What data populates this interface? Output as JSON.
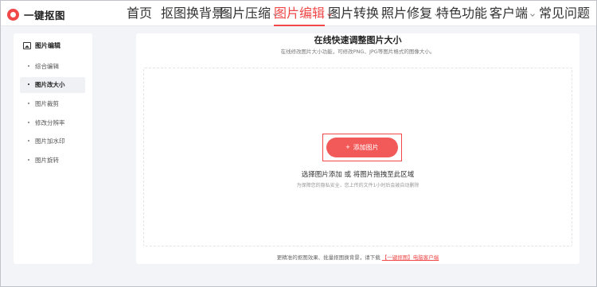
{
  "header": {
    "logo_text": "一键抠图",
    "nav": [
      {
        "label": "首页",
        "has_dropdown": false,
        "active": false
      },
      {
        "label": "抠图换背景",
        "has_dropdown": true,
        "active": false
      },
      {
        "label": "图片压缩",
        "has_dropdown": true,
        "active": false
      },
      {
        "label": "图片编辑",
        "has_dropdown": true,
        "active": true
      },
      {
        "label": "图片转换",
        "has_dropdown": true,
        "active": false
      },
      {
        "label": "照片修复",
        "has_dropdown": true,
        "active": false
      },
      {
        "label": "特色功能",
        "has_dropdown": true,
        "active": false
      },
      {
        "label": "客户端",
        "has_dropdown": true,
        "active": false
      },
      {
        "label": "常见问题",
        "has_dropdown": false,
        "active": false
      }
    ]
  },
  "sidebar": {
    "title": "图片编辑",
    "items": [
      {
        "label": "综合编辑",
        "active": false
      },
      {
        "label": "图片改大小",
        "active": true
      },
      {
        "label": "图片裁剪",
        "active": false
      },
      {
        "label": "修改分辨率",
        "active": false
      },
      {
        "label": "图片加水印",
        "active": false
      },
      {
        "label": "图片旋转",
        "active": false
      }
    ]
  },
  "main": {
    "title": "在线快速调整图片大小",
    "subtitle": "在线修改图片大小功能，可修改PNG、JPG等图片格式的图像大小。",
    "add_button": "添加图片",
    "drop_text": "选择图片添加 或 将图片拖拽至此区域",
    "drop_note": "为保障您的隐私安全，您上传的文件1小时后会被自动删除",
    "footer_text": "更精准的抠图效果、批量抠图换背景，请下载",
    "footer_link": "【一键抠图】电脑客户端"
  },
  "colors": {
    "accent": "#f04848",
    "button": "#f25a5a",
    "background": "#f3f4f7"
  }
}
